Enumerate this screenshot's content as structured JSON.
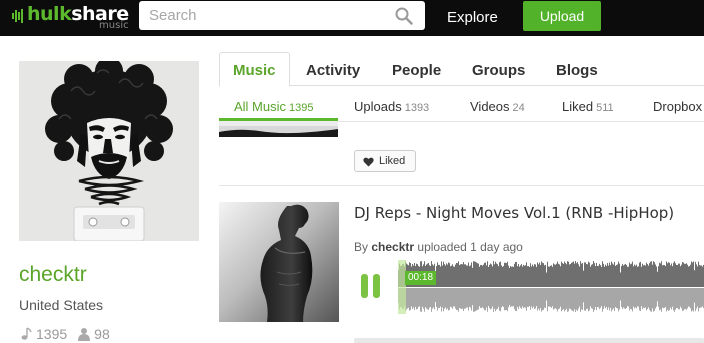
{
  "header": {
    "logo_main": "hulk",
    "logo_main_bold": "share",
    "logo_sub": "music",
    "search_placeholder": "Search",
    "explore_label": "Explore",
    "upload_label": "Upload",
    "accent_color": "#5cb82c"
  },
  "profile": {
    "username": "checktr",
    "country": "United States",
    "tracks_count": "1395",
    "followers_count": "98",
    "edit_icon": "pencil-icon"
  },
  "tabs": [
    {
      "label": "Music",
      "active": true
    },
    {
      "label": "Activity"
    },
    {
      "label": "People"
    },
    {
      "label": "Groups"
    },
    {
      "label": "Blogs"
    }
  ],
  "subtabs": [
    {
      "label": "All Music",
      "count": "1395",
      "active": true
    },
    {
      "label": "Uploads",
      "count": "1393"
    },
    {
      "label": "Videos",
      "count": "24"
    },
    {
      "label": "Liked",
      "count": "511"
    },
    {
      "label": "Dropbox",
      "count": ""
    }
  ],
  "feed": {
    "liked_label": "Liked",
    "track": {
      "title": "DJ Reps - Night Moves Vol.1 (RNB -HipHop)",
      "by_label": "By",
      "author": "checktr",
      "action": "uploaded 1 day ago",
      "current_time": "00:18",
      "progress": 0.03
    }
  }
}
